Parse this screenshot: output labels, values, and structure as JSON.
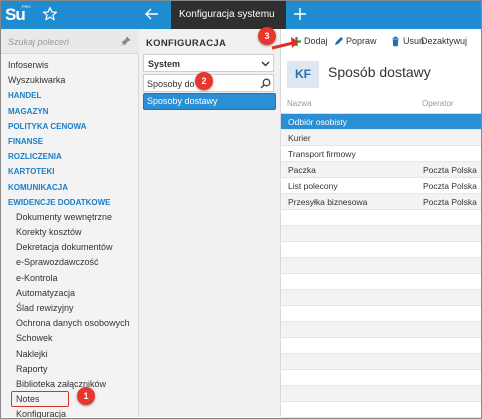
{
  "app": {
    "logo_text": "Su",
    "logo_sub": "PRO"
  },
  "tabs": [
    {
      "label": "Konfiguracja systemu"
    }
  ],
  "left": {
    "search_placeholder": "Szukaj poleceń",
    "items": [
      {
        "label": "Infoserwis",
        "kind": "item"
      },
      {
        "label": "Wyszukiwarka",
        "kind": "item"
      },
      {
        "label": "HANDEL",
        "kind": "group"
      },
      {
        "label": "MAGAZYN",
        "kind": "group"
      },
      {
        "label": "POLITYKA CENOWA",
        "kind": "group"
      },
      {
        "label": "FINANSE",
        "kind": "group"
      },
      {
        "label": "ROZLICZENIA",
        "kind": "group"
      },
      {
        "label": "KARTOTEKI",
        "kind": "group"
      },
      {
        "label": "KOMUNIKACJA",
        "kind": "group"
      },
      {
        "label": "EWIDENCJE DODATKOWE",
        "kind": "group"
      },
      {
        "label": "Dokumenty wewnętrzne",
        "kind": "sub"
      },
      {
        "label": "Korekty kosztów",
        "kind": "sub"
      },
      {
        "label": "Dekretacja dokumentów",
        "kind": "sub"
      },
      {
        "label": "e-Sprawozdawczość",
        "kind": "sub"
      },
      {
        "label": "e-Kontrola",
        "kind": "sub"
      },
      {
        "label": "Automatyzacja",
        "kind": "sub"
      },
      {
        "label": "Ślad rewizyjny",
        "kind": "sub"
      },
      {
        "label": "Ochrona danych osobowych",
        "kind": "sub"
      },
      {
        "label": "Schowek",
        "kind": "sub"
      },
      {
        "label": "Naklejki",
        "kind": "sub"
      },
      {
        "label": "Raporty",
        "kind": "sub"
      },
      {
        "label": "Biblioteka załączników",
        "kind": "sub"
      },
      {
        "label": "Notes",
        "kind": "sub"
      },
      {
        "label": "Konfiguracja",
        "kind": "sub"
      }
    ]
  },
  "middle": {
    "title": "KONFIGURACJA",
    "select_value": "System",
    "search_value": "Sposoby do",
    "selected_item": "Sposoby dostawy"
  },
  "toolbar": {
    "add": "Dodaj",
    "edit": "Popraw",
    "delete": "Usuń",
    "deactivate": "Dezaktywuj"
  },
  "right": {
    "icon_text": "KF",
    "title": "Sposób dostawy",
    "columns": [
      "Nazwa",
      "Operator"
    ],
    "rows": [
      {
        "name": "Odbiór osobisty",
        "operator": ""
      },
      {
        "name": "Kurier",
        "operator": ""
      },
      {
        "name": "Transport firmowy",
        "operator": ""
      },
      {
        "name": "Paczka",
        "operator": "Poczta Polska"
      },
      {
        "name": "List polecony",
        "operator": "Poczta Polska"
      },
      {
        "name": "Przesyłka biznesowa",
        "operator": "Poczta Polska"
      },
      {
        "name": "",
        "operator": ""
      },
      {
        "name": "",
        "operator": ""
      },
      {
        "name": "",
        "operator": ""
      },
      {
        "name": "",
        "operator": ""
      },
      {
        "name": "",
        "operator": ""
      },
      {
        "name": "",
        "operator": ""
      },
      {
        "name": "",
        "operator": ""
      },
      {
        "name": "",
        "operator": ""
      },
      {
        "name": "",
        "operator": ""
      },
      {
        "name": "",
        "operator": ""
      },
      {
        "name": "",
        "operator": ""
      },
      {
        "name": "",
        "operator": ""
      },
      {
        "name": "",
        "operator": ""
      }
    ]
  },
  "callouts": [
    "1",
    "2",
    "3"
  ],
  "colors": {
    "accent": "#1f8bd0",
    "selection": "#2a8fd4",
    "callout": "#e8352e",
    "group": "#1a7fc4"
  }
}
